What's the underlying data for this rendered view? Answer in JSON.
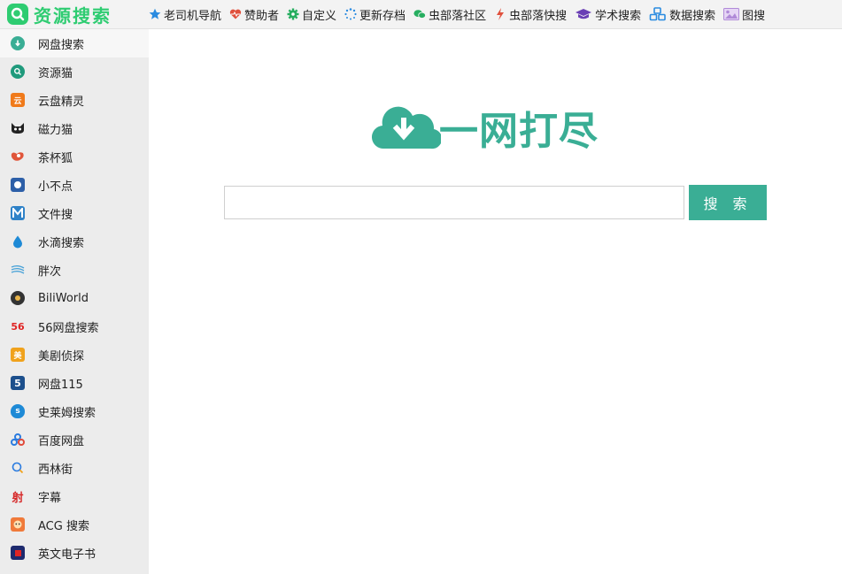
{
  "brand": {
    "title": "资源搜索",
    "color": "#2ecc71"
  },
  "nav": [
    {
      "label": "老司机导航",
      "icon": "star-icon",
      "color": "#2a8be0"
    },
    {
      "label": "赞助者",
      "icon": "heart-pulse-icon",
      "color": "#e0503c"
    },
    {
      "label": "自定义",
      "icon": "gear-icon",
      "color": "#27ae60"
    },
    {
      "label": "更新存档",
      "icon": "spinner-icon",
      "color": "#2a8be0"
    },
    {
      "label": "虫部落社区",
      "icon": "chat-icon",
      "color": "#27ae60"
    },
    {
      "label": "虫部落快搜",
      "icon": "lightning-icon",
      "color": "#e0503c"
    },
    {
      "label": "学术搜索",
      "icon": "graduation-cap-icon",
      "color": "#6a3fb5"
    },
    {
      "label": "数据搜索",
      "icon": "cubes-icon",
      "color": "#2a8be0"
    },
    {
      "label": "图搜",
      "icon": "image-icon",
      "color": "#b08ad8"
    }
  ],
  "sidebar": {
    "items": [
      {
        "label": "网盘搜索",
        "icon": "cloud-download-icon",
        "active": true
      },
      {
        "label": "资源猫",
        "icon": "search-circle-icon"
      },
      {
        "label": "云盘精灵",
        "icon": "yun-icon"
      },
      {
        "label": "磁力猫",
        "icon": "cat-icon"
      },
      {
        "label": "茶杯狐",
        "icon": "fox-icon"
      },
      {
        "label": "小不点",
        "icon": "square-dot-icon"
      },
      {
        "label": "文件搜",
        "icon": "m-logo-icon"
      },
      {
        "label": "水滴搜索",
        "icon": "water-drop-icon"
      },
      {
        "label": "胖次",
        "icon": "wave-icon"
      },
      {
        "label": "BiliWorld",
        "icon": "bili-circle-icon"
      },
      {
        "label": "56网盘搜索",
        "icon": "56-logo-icon"
      },
      {
        "label": "美剧侦探",
        "icon": "mei-icon"
      },
      {
        "label": "网盘115",
        "icon": "five-icon"
      },
      {
        "label": "史莱姆搜索",
        "icon": "slime-icon"
      },
      {
        "label": "百度网盘",
        "icon": "baidu-pan-icon"
      },
      {
        "label": "西林街",
        "icon": "xilinjie-icon"
      },
      {
        "label": "字幕",
        "icon": "zimu-icon"
      },
      {
        "label": "ACG 搜索",
        "icon": "acg-icon"
      },
      {
        "label": "英文电子书",
        "icon": "ebook-icon"
      }
    ]
  },
  "main": {
    "hero_title": "一网打尽",
    "hero_icon": "cloud-download-icon",
    "accent": "#3aae95",
    "search_placeholder": "",
    "search_value": "",
    "search_button": "搜 索"
  }
}
